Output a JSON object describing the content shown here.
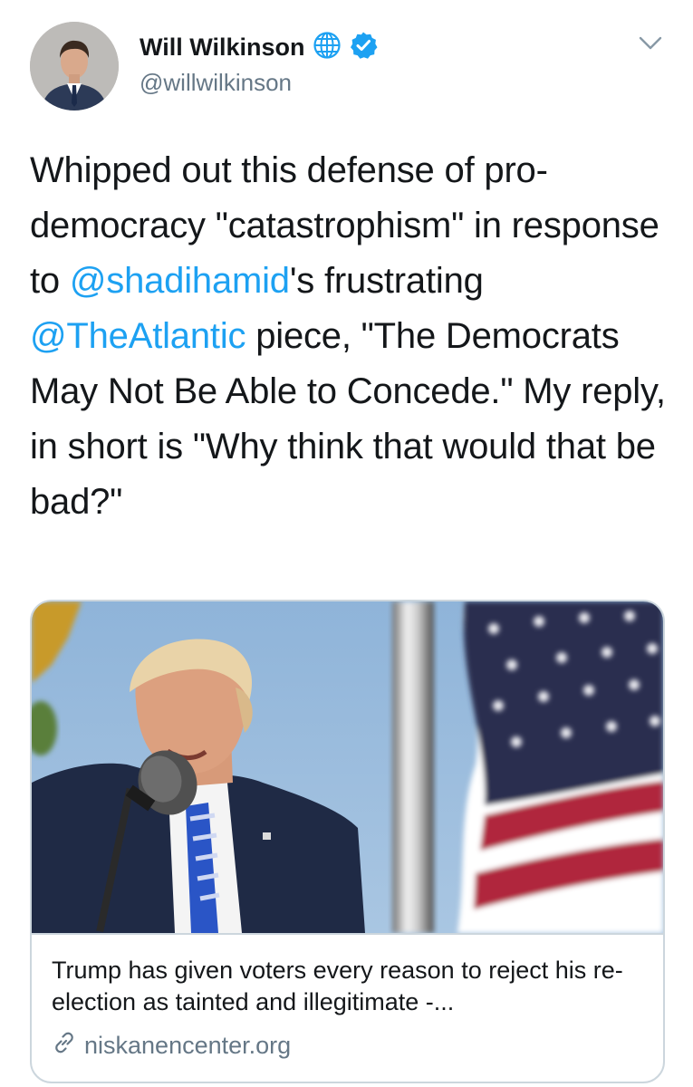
{
  "author": {
    "display_name": "Will Wilkinson",
    "handle": "@willwilkinson",
    "globe_icon": "globe-icon",
    "verified_icon": "verified-badge-icon",
    "verified_color": "#1da1f2"
  },
  "menu": {
    "icon": "chevron-down-icon"
  },
  "tweet": {
    "segments": [
      {
        "text": "Whipped out this defense of pro-democracy \"catastrophism\" in response to ",
        "type": "text"
      },
      {
        "text": "@shadihamid",
        "type": "mention"
      },
      {
        "text": "'s frustrating ",
        "type": "text"
      },
      {
        "text": "@TheAtlantic",
        "type": "mention"
      },
      {
        "text": " piece, \"The Democrats May Not Be Able to Concede.\" My reply, in short is \"Why think that would that be bad?\"",
        "type": "text"
      }
    ],
    "mention_color": "#1da1f2"
  },
  "card": {
    "title": "Trump has given voters every reason to reject his re-election as tainted and illegitimate -...",
    "domain": "niskanencenter.org",
    "link_icon": "link-icon"
  }
}
